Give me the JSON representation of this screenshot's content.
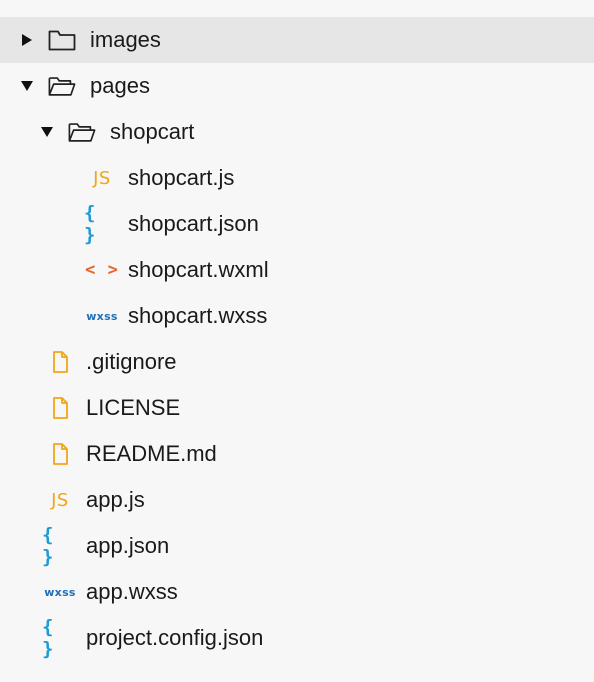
{
  "colors": {
    "js": "#f2a516",
    "json": "#1f9ad6",
    "wxml": "#e8622b",
    "wxss": "#1f6fb8",
    "file": "#f2a516",
    "selected_row": "#e6e6e6"
  },
  "tree": {
    "images": {
      "label": "images",
      "icon": "folder-closed-icon",
      "expanded": false
    },
    "pages": {
      "label": "pages",
      "icon": "folder-open-icon",
      "expanded": true
    },
    "shopcart": {
      "label": "shopcart",
      "icon": "folder-open-icon",
      "expanded": true
    },
    "shopcart_js": {
      "label": "shopcart.js",
      "badge": "JS"
    },
    "shopcart_json": {
      "label": "shopcart.json",
      "badge": "{ }"
    },
    "shopcart_wxml": {
      "label": "shopcart.wxml",
      "badge": "< >"
    },
    "shopcart_wxss": {
      "label": "shopcart.wxss",
      "badge": "WXSS"
    },
    "gitignore": {
      "label": ".gitignore",
      "icon": "file-icon"
    },
    "license": {
      "label": "LICENSE",
      "icon": "file-icon"
    },
    "readme": {
      "label": "README.md",
      "icon": "file-icon"
    },
    "app_js": {
      "label": "app.js",
      "badge": "JS"
    },
    "app_json": {
      "label": "app.json",
      "badge": "{ }"
    },
    "app_wxss": {
      "label": "app.wxss",
      "badge": "WXSS"
    },
    "project_config": {
      "label": "project.config.json",
      "badge": "{ }"
    }
  }
}
